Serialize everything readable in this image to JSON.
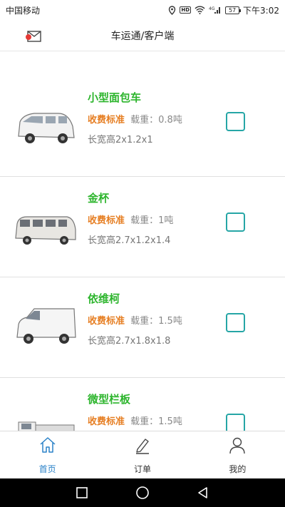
{
  "status_bar": {
    "carrier": "中国移动",
    "network": "4G",
    "battery": "57",
    "time": "下午3:02",
    "hd_label": "HD"
  },
  "header": {
    "title": "车运通/客户端",
    "message_icon": "mail-notification-icon"
  },
  "vehicles": [
    {
      "name": "小型面包车",
      "fee_label": "收费标准",
      "load": "载重：0.8吨",
      "dims": "长宽高2x1.2x1",
      "selected": false
    },
    {
      "name": "金杯",
      "fee_label": "收费标准",
      "load": "载重：1吨",
      "dims": "长宽高2.7x1.2x1.4",
      "selected": false
    },
    {
      "name": "依维柯",
      "fee_label": "收费标准",
      "load": "载重：1.5吨",
      "dims": "长宽高2.7x1.8x1.8",
      "selected": false
    },
    {
      "name": "微型栏板",
      "fee_label": "收费标准",
      "load": "载重：1.5吨",
      "dims": "",
      "selected": false
    }
  ],
  "tabs": [
    {
      "label": "首页",
      "icon": "home-icon",
      "active": true
    },
    {
      "label": "订单",
      "icon": "pencil-icon",
      "active": false
    },
    {
      "label": "我的",
      "icon": "user-icon",
      "active": false
    }
  ],
  "colors": {
    "vehicle_name": "#2db52d",
    "fee_label": "#e67e22",
    "checkbox_border": "#26a6a6",
    "active_tab": "#2a82c8"
  }
}
